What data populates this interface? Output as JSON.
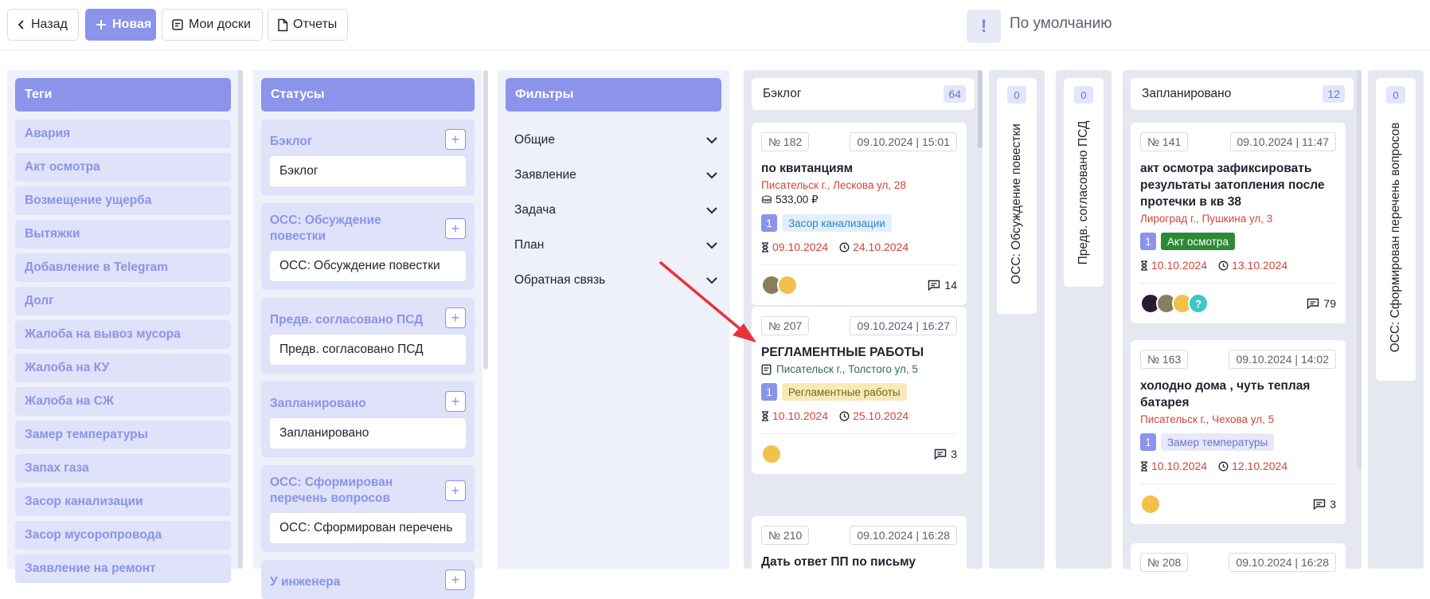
{
  "toolbar": {
    "back_label": "Назад",
    "new_label": "Новая",
    "boards_label": "Мои доски",
    "reports_label": "Отчеты",
    "view_badge": "!",
    "view_label": "По умолчанию"
  },
  "tags_panel": {
    "title": "Теги",
    "items": [
      "Авария",
      "Акт осмотра",
      "Возмещение ущерба",
      "Вытяжки",
      "Добавление в Telegram",
      "Долг",
      "Жалоба на вывоз мусора",
      "Жалоба на КУ",
      "Жалоба на СЖ",
      "Замер температуры",
      "Запах газа",
      "Засор канализации",
      "Засор мусоропровода",
      "Заявление на ремонт"
    ]
  },
  "statuses_panel": {
    "title": "Статусы",
    "items": [
      {
        "title": "Бэклог",
        "value": "Бэклог"
      },
      {
        "title": "ОСС: Обсуждение повестки",
        "value": "ОСС: Обсуждение повестки"
      },
      {
        "title": "Предв. согласовано ПСД",
        "value": "Предв. согласовано ПСД"
      },
      {
        "title": "Запланировано",
        "value": "Запланировано"
      },
      {
        "title": "ОСС: Сформирован перечень вопросов",
        "value": "ОСС: Сформирован перечень"
      },
      {
        "title": "У инженера",
        "value": ""
      }
    ],
    "add_symbol": "+"
  },
  "filters_panel": {
    "title": "Фильтры",
    "items": [
      "Общие",
      "Заявление",
      "Задача",
      "План",
      "Обратная связь"
    ]
  },
  "board": {
    "columns": [
      {
        "title": "Бэклог",
        "count": "64",
        "cards": [
          {
            "number": "№ 182",
            "datetime": "09.10.2024 | 15:01",
            "title": "по квитанциям",
            "address": "Писательск г., Лескова ул, 28",
            "price": "533,00 ₽",
            "tag_num": "1",
            "tag": "Засор канализации",
            "start": "09.10.2024",
            "due": "24.10.2024",
            "comments": "14"
          },
          {
            "number": "№ 207",
            "datetime": "09.10.2024 | 16:27",
            "title": "РЕГЛАМЕНТНЫЕ РАБОТЫ",
            "address": "Писательск г., Толстого ул, 5",
            "tag_num": "1",
            "tag": "Регламентные работы",
            "start": "10.10.2024",
            "due": "25.10.2024",
            "comments": "3"
          },
          {
            "number": "№ 210",
            "datetime": "09.10.2024 | 16:28",
            "title": "Дать ответ ПП по письму"
          }
        ]
      },
      {
        "title": "ОСС: Обсуждение повестки",
        "count": "0"
      },
      {
        "title": "Предв. согласовано ПСД",
        "count": "0"
      },
      {
        "title": "Запланировано",
        "count": "12",
        "cards": [
          {
            "number": "№ 141",
            "datetime": "09.10.2024 | 11:47",
            "title": "акт осмотра зафиксировать результаты затопления после протечки в кв 38",
            "address": "Лирогpад г., Пушкина ул, 3",
            "tag_num": "1",
            "tag": "Акт осмотра",
            "start": "10.10.2024",
            "due": "13.10.2024",
            "comments": "79",
            "extra_avatar": "?"
          },
          {
            "number": "№ 163",
            "datetime": "09.10.2024 | 14:02",
            "title": "холодно дома , чуть теплая батарея",
            "address": "Писательск г., Чехова ул, 5",
            "tag_num": "1",
            "tag": "Замер температуры",
            "start": "10.10.2024",
            "due": "12.10.2024",
            "comments": "3"
          },
          {
            "number": "№ 208",
            "datetime": "09.10.2024 | 16:28"
          }
        ]
      },
      {
        "title": "ОСС: Сформирован перечень вопросов",
        "count": "0"
      }
    ]
  },
  "colors": {
    "accent": "#8b93ea",
    "danger": "#d2453a",
    "annotation_arrow": "#e8323a"
  }
}
